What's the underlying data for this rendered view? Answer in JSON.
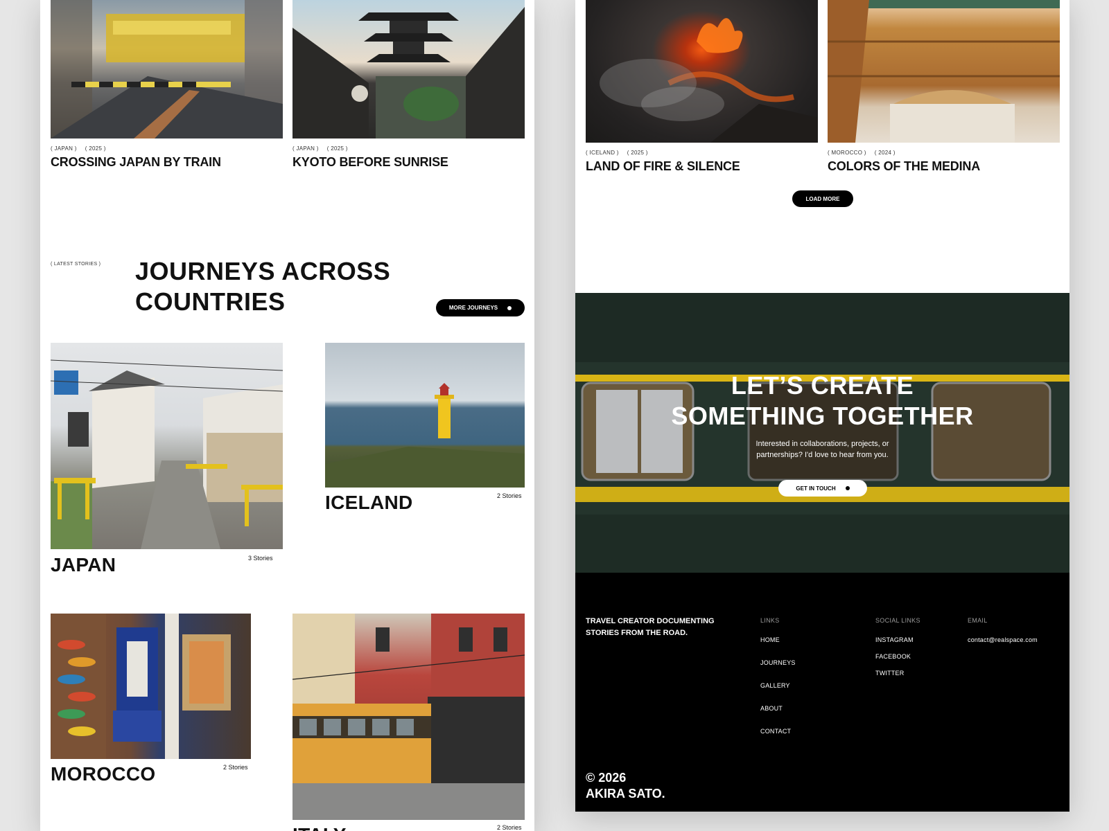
{
  "left": {
    "featured": [
      {
        "country": "JAPAN",
        "year": "2025",
        "title": "CROSSING JAPAN BY TRAIN"
      },
      {
        "country": "JAPAN",
        "year": "2025",
        "title": "KYOTO BEFORE SUNRISE"
      }
    ],
    "section_label": "( LATEST STORIES )",
    "section_title_line1": "JOURNEYS ACROSS",
    "section_title_line2": "COUNTRIES",
    "more_button": "MORE JOURNEYS",
    "countries": [
      {
        "name": "JAPAN",
        "count": "3 Stories"
      },
      {
        "name": "ICELAND",
        "count": "2 Stories"
      },
      {
        "name": "MOROCCO",
        "count": "2 Stories"
      },
      {
        "name": "ITALY",
        "count": "2 Stories"
      }
    ]
  },
  "right": {
    "featured": [
      {
        "country": "ICELAND",
        "year": "2025",
        "title": "LAND OF FIRE & SILENCE"
      },
      {
        "country": "MOROCCO",
        "year": "2024",
        "title": "COLORS OF THE MEDINA"
      }
    ],
    "load_more": "LOAD MORE",
    "cta": {
      "line1": "LET’S CREATE",
      "line2": "SOMETHING TOGETHER",
      "sub1": "Interested in collaborations, projects, or",
      "sub2": "partnerships? I'd love to hear from you.",
      "button": "GET IN TOUCH"
    },
    "footer": {
      "tagline1": "TRAVEL CREATOR DOCUMENTING",
      "tagline2": "STORIES FROM THE ROAD.",
      "links_heading": "LINKS",
      "links": [
        "HOME",
        "JOURNEYS",
        "GALLERY",
        "ABOUT",
        "CONTACT"
      ],
      "social_heading": "SOCIAL LINKS",
      "social": [
        "INSTAGRAM",
        "FACEBOOK",
        "TWITTER"
      ],
      "email_heading": "EMAIL",
      "email": "contact@realspace.com",
      "copyright1": "© 2026",
      "copyright2": "AKIRA SATO."
    }
  },
  "colors": {
    "accent_yellow": "#e5c21a",
    "black": "#000000",
    "train_green": "#23332b"
  }
}
